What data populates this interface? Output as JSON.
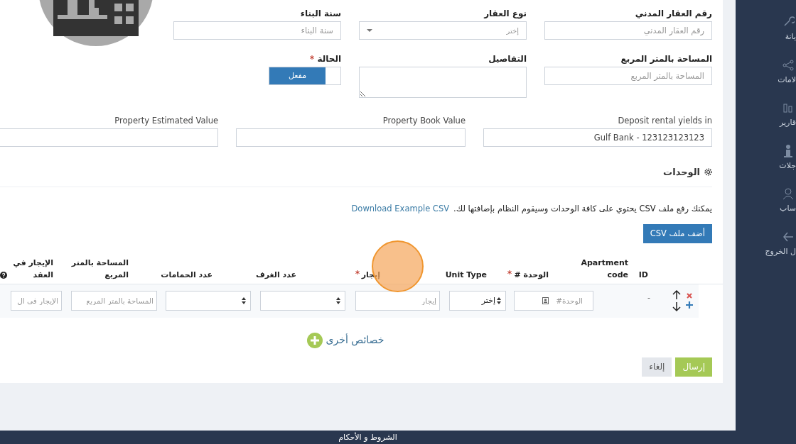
{
  "form": {
    "rows": [
      [
        {
          "kind": "input",
          "label": "رقم العقار المدني",
          "placeholder": "رقم العقار المدني"
        },
        {
          "kind": "select",
          "label": "نوع العقار",
          "placeholder": "إختر"
        },
        {
          "kind": "input",
          "label": "سنة البناء",
          "placeholder": "سنة البناء"
        }
      ],
      [
        {
          "kind": "input",
          "label": "المساحة بالمتر المربع",
          "placeholder": "المساحة بالمتر المربع"
        },
        {
          "kind": "textarea",
          "label": "التفاصيل"
        },
        {
          "kind": "toggle",
          "label": "الحالة",
          "required": true,
          "on": true,
          "text": "مفعل"
        }
      ],
      [
        {
          "kind": "input",
          "label": "Deposit rental yields in",
          "value": "Gulf Bank - 123123123123"
        },
        {
          "kind": "input",
          "label": "Property Book Value"
        },
        {
          "kind": "input",
          "label": "Property Estimated Value"
        }
      ]
    ]
  },
  "units": {
    "title": "الوحدات",
    "description": "يمكنك رفع ملف CSV يحتوي على كافة الوحدات وسيقوم النظام بإضافتها لك.",
    "link": "Download Example CSV",
    "upload_button": "أضف ملف CSV",
    "columns": [
      {
        "label": "ID"
      },
      {
        "label": "Apartment code"
      },
      {
        "label": "الوحدة #",
        "required": true
      },
      {
        "label": "Unit Type"
      },
      {
        "label": "إيجار",
        "required": true
      },
      {
        "label": "عدد الغرف"
      },
      {
        "label": "عدد الحمامات"
      },
      {
        "label": "المساحة بالمتر المربع"
      },
      {
        "label": "الإيجار في العقد",
        "help": true
      }
    ],
    "rows": [
      {
        "cells": [
          {
            "kind": "text",
            "text": "-"
          },
          {
            "kind": "empty"
          },
          {
            "kind": "input",
            "placeholder": "الوحدة#",
            "icon": true
          },
          {
            "kind": "select",
            "placeholder": "إختر"
          },
          {
            "kind": "input",
            "placeholder": "إيجار"
          },
          {
            "kind": "select"
          },
          {
            "kind": "select"
          },
          {
            "kind": "input",
            "placeholder": "المساحة بالمتر المربع"
          },
          {
            "kind": "input",
            "placeholder": "الإيجار في ال"
          }
        ]
      }
    ]
  },
  "more_link": "خصائص أخرى",
  "buttons": [
    {
      "kind": "primary",
      "label": "إرسال"
    },
    {
      "kind": "secondary",
      "label": "إلغاء"
    }
  ],
  "footer": "الشروط و الأحكام",
  "sidebar": {
    "items": [
      {
        "kind": "wrench",
        "label": "يانة"
      },
      {
        "kind": "share",
        "label": "لامات"
      },
      {
        "kind": "chart",
        "label": "قارير"
      },
      {
        "kind": "info",
        "label": "جلات"
      },
      {
        "kind": "user",
        "label": "ساب"
      },
      {
        "kind": "exit",
        "label": "ل الخروج"
      }
    ]
  }
}
